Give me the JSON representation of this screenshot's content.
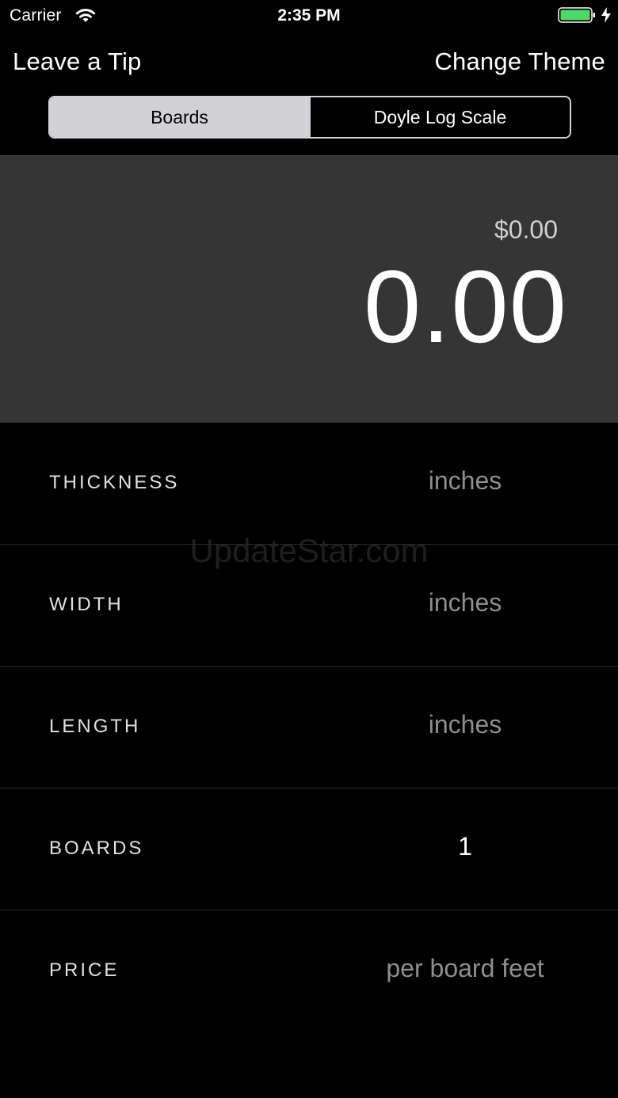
{
  "status_bar": {
    "carrier": "Carrier",
    "time": "2:35 PM",
    "wifi_icon": "wifi-icon",
    "battery_icon": "battery-icon",
    "charging_icon": "charging-bolt-icon",
    "battery_color": "#4cd964"
  },
  "nav": {
    "left_label": "Leave a Tip",
    "right_label": "Change Theme"
  },
  "segments": {
    "items": [
      {
        "label": "Boards",
        "selected": true
      },
      {
        "label": "Doyle Log Scale",
        "selected": false
      }
    ]
  },
  "result": {
    "cost": "$0.00",
    "value": "0.00"
  },
  "rows": [
    {
      "label": "THICKNESS",
      "value": "",
      "placeholder": "inches"
    },
    {
      "label": "WIDTH",
      "value": "",
      "placeholder": "inches"
    },
    {
      "label": "LENGTH",
      "value": "",
      "placeholder": "inches"
    },
    {
      "label": "BOARDS",
      "value": "1",
      "placeholder": ""
    },
    {
      "label": "PRICE",
      "value": "",
      "placeholder": "per board feet"
    }
  ],
  "watermark": "UpdateStar.com",
  "colors": {
    "background": "#000000",
    "panel": "#353535",
    "segment_selected": "#d1d1d6",
    "placeholder": "#8e8e8e"
  }
}
